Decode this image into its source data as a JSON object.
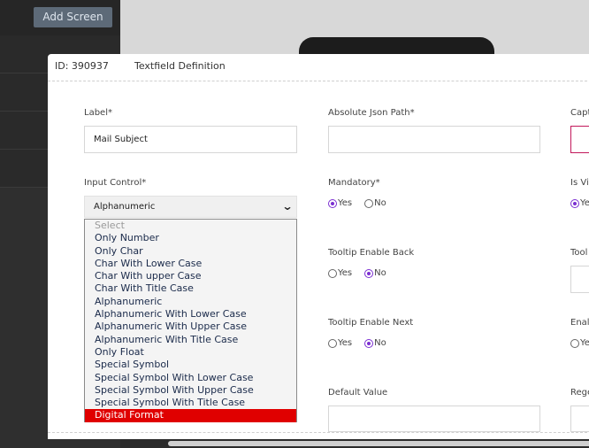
{
  "background": {
    "add_screen_label": "Add Screen"
  },
  "modal": {
    "id_text": "ID: 390937",
    "title": "Textfield Definition"
  },
  "form": {
    "label": {
      "label": "Label*",
      "value": "Mail Subject"
    },
    "absolute_json_path": {
      "label": "Absolute Json Path*",
      "value": ""
    },
    "caption_partial": {
      "label": "Capt"
    },
    "input_control": {
      "label": "Input Control*",
      "value": "Alphanumeric"
    },
    "mandatory": {
      "label": "Mandatory*",
      "yes": "Yes",
      "no": "No",
      "selected": "Yes"
    },
    "is_visible_partial": {
      "label": "Is Vi",
      "yes": "Ye",
      "selected": "Yes"
    },
    "tooltip_enable_back": {
      "label": "Tooltip Enable Back",
      "yes": "Yes",
      "no": "No",
      "selected": "No"
    },
    "tooltip_partial": {
      "label": "Tool"
    },
    "tooltip_enable_next": {
      "label": "Tooltip Enable Next",
      "yes": "Yes",
      "no": "No",
      "selected": "No"
    },
    "enable_partial": {
      "label": "Enal",
      "yes": "Ye"
    },
    "default_value": {
      "label": "Default Value",
      "value": ""
    },
    "regex_partial": {
      "label": "Rege"
    }
  },
  "dropdown": {
    "options": [
      "Select",
      "Only Number",
      "Only Char",
      "Char With Lower Case",
      "Char With upper Case",
      "Char With Title Case",
      "Alphanumeric",
      "Alphanumeric With Lower Case",
      "Alphanumeric With Upper Case",
      "Alphanumeric With Title Case",
      "Only Float",
      "Special Symbol",
      "Special Symbol With Lower Case",
      "Special Symbol With Upper Case",
      "Special Symbol With Title Case",
      "Digital Format"
    ],
    "highlighted": "Digital Format"
  },
  "colors": {
    "accent_radio": "#7b2fd1",
    "highlight": "#e00000",
    "caption_border": "#c2185b"
  }
}
